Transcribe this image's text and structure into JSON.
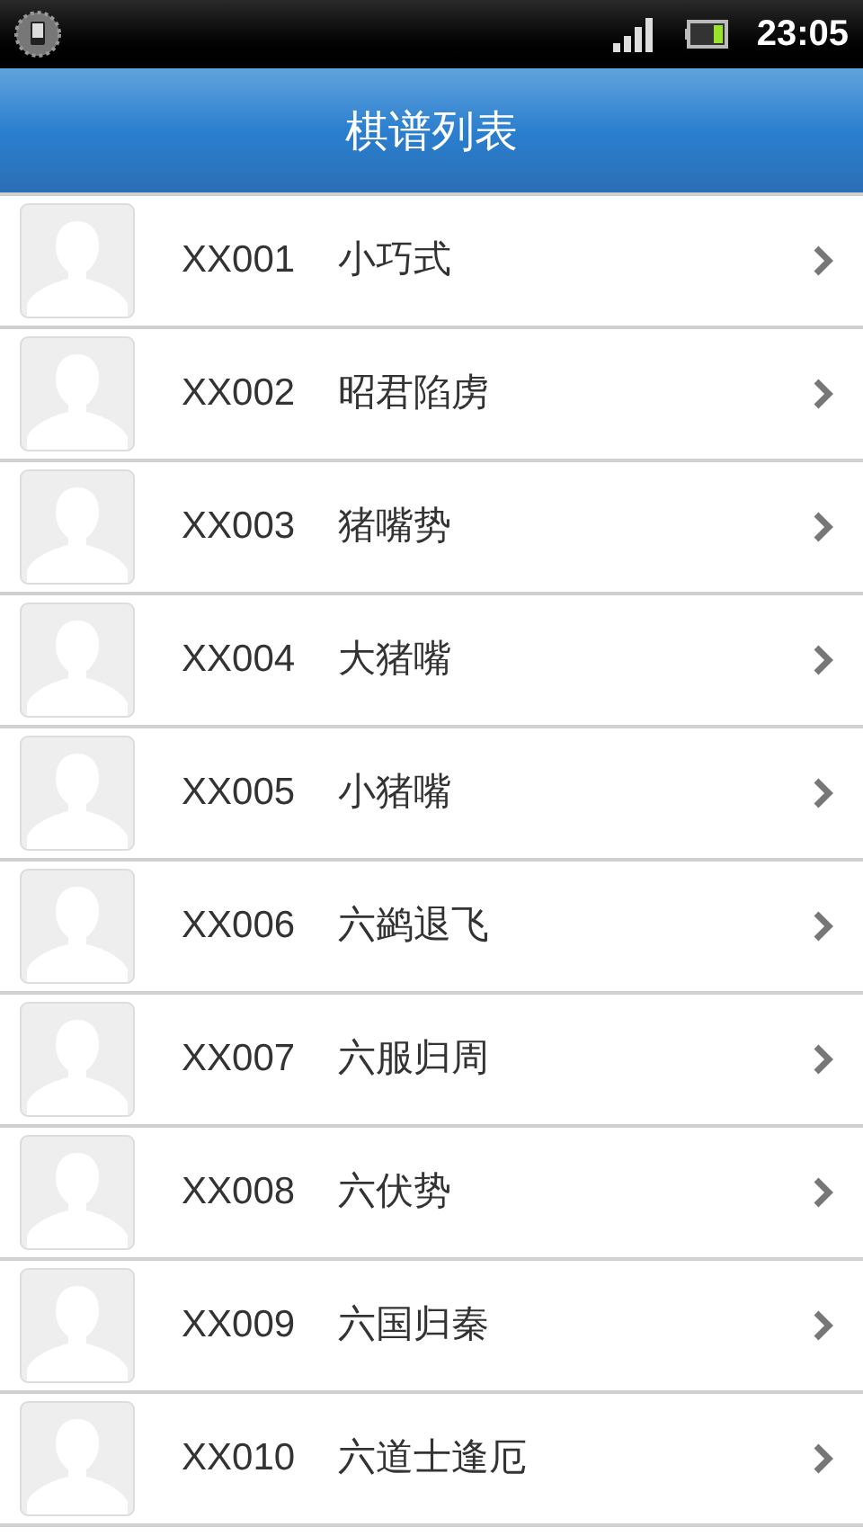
{
  "status_bar": {
    "time": "23:05"
  },
  "title_bar": {
    "title": "棋谱列表"
  },
  "list": [
    {
      "code": "XX001",
      "name": "小巧式"
    },
    {
      "code": "XX002",
      "name": "昭君陷虏"
    },
    {
      "code": "XX003",
      "name": "猪嘴势"
    },
    {
      "code": "XX004",
      "name": "大猪嘴"
    },
    {
      "code": "XX005",
      "name": "小猪嘴"
    },
    {
      "code": "XX006",
      "name": "六鹢退飞"
    },
    {
      "code": "XX007",
      "name": "六服归周"
    },
    {
      "code": "XX008",
      "name": "六伏势"
    },
    {
      "code": "XX009",
      "name": "六国归秦"
    },
    {
      "code": "XX010",
      "name": "六道士逢厄"
    }
  ]
}
